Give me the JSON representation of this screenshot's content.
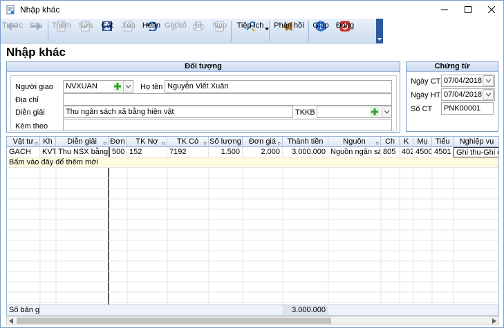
{
  "window": {
    "title": "Nhập khác",
    "controls": [
      "minimize-icon",
      "maximize-icon",
      "close-icon"
    ]
  },
  "toolbar": [
    {
      "label": "Trước",
      "icon": "arrow-left-icon",
      "enabled": false
    },
    {
      "label": "Sau",
      "icon": "arrow-right-icon",
      "enabled": false
    },
    {
      "label": "Thêm",
      "icon": "add-document-icon",
      "enabled": false
    },
    {
      "label": "Sửa",
      "icon": "edit-document-icon",
      "enabled": false
    },
    {
      "label": "Cất",
      "icon": "save-icon",
      "enabled": true
    },
    {
      "label": "Xóa",
      "icon": "delete-icon",
      "enabled": false
    },
    {
      "label": "Hoãn",
      "icon": "undo-icon",
      "enabled": true
    },
    {
      "label": "Ghi sổ",
      "icon": "pencil-icon",
      "enabled": false
    },
    {
      "label": "In",
      "icon": "print-icon",
      "enabled": false
    },
    {
      "label": "Nạp",
      "icon": "load-icon",
      "enabled": false
    },
    {
      "label": "Tiện ích",
      "icon": "utilities-icon",
      "enabled": true
    },
    {
      "label": "Phản hồi",
      "icon": "megaphone-icon",
      "enabled": true
    },
    {
      "label": "Giúp",
      "icon": "help-icon",
      "enabled": true
    },
    {
      "label": "Đóng",
      "icon": "power-icon",
      "enabled": true
    }
  ],
  "page_title": "Nhập khác",
  "doi_tuong": {
    "header": "Đối tượng",
    "nguoi_giao_label": "Người giao",
    "nguoi_giao_value": "NVXUAN",
    "ho_ten_label": "Họ tên",
    "ho_ten_value": "Nguyễn Viết Xuân",
    "dia_chi_label": "Địa chỉ",
    "dia_chi_value": "",
    "dien_giai_label": "Diễn giải",
    "dien_giai_value": "Thu ngân sách xã bằng hiện vật",
    "tkkb_label": "TKKB",
    "tkkb_value": "",
    "kem_theo_label": "Kèm theo",
    "kem_theo_value": ""
  },
  "chung_tu": {
    "header": "Chứng từ",
    "ngay_ct_label": "Ngày CT",
    "ngay_ct_value": "07/04/2018",
    "ngay_ht_label": "Ngày HT",
    "ngay_ht_value": "07/04/2018",
    "so_ct_label": "Số CT",
    "so_ct_value": "PNK00001"
  },
  "grid": {
    "columns": [
      "Vật tư",
      "Kh",
      "Diễn giải",
      "Đơn",
      "TK Nợ",
      "TK Có",
      "Số lượng",
      "Đơn giá",
      "Thành tiền",
      "Nguồn",
      "Ch",
      "K",
      "Mụ",
      "Tiểu",
      "Nghiệp vụ"
    ],
    "rows": [
      [
        "GACH",
        "KVT",
        "Thu NSX bằng...",
        "500",
        "152",
        "7192",
        "1.500",
        "2.000",
        "3.000.000",
        "Nguồn ngân sác...",
        "805",
        "402",
        "4500",
        "4501",
        "Ghi thu-Ghi chi"
      ]
    ],
    "new_row_hint": "Bấm vào đây để thêm mới",
    "footer_label": "Số bản g...",
    "footer_total": "3.000.000"
  }
}
